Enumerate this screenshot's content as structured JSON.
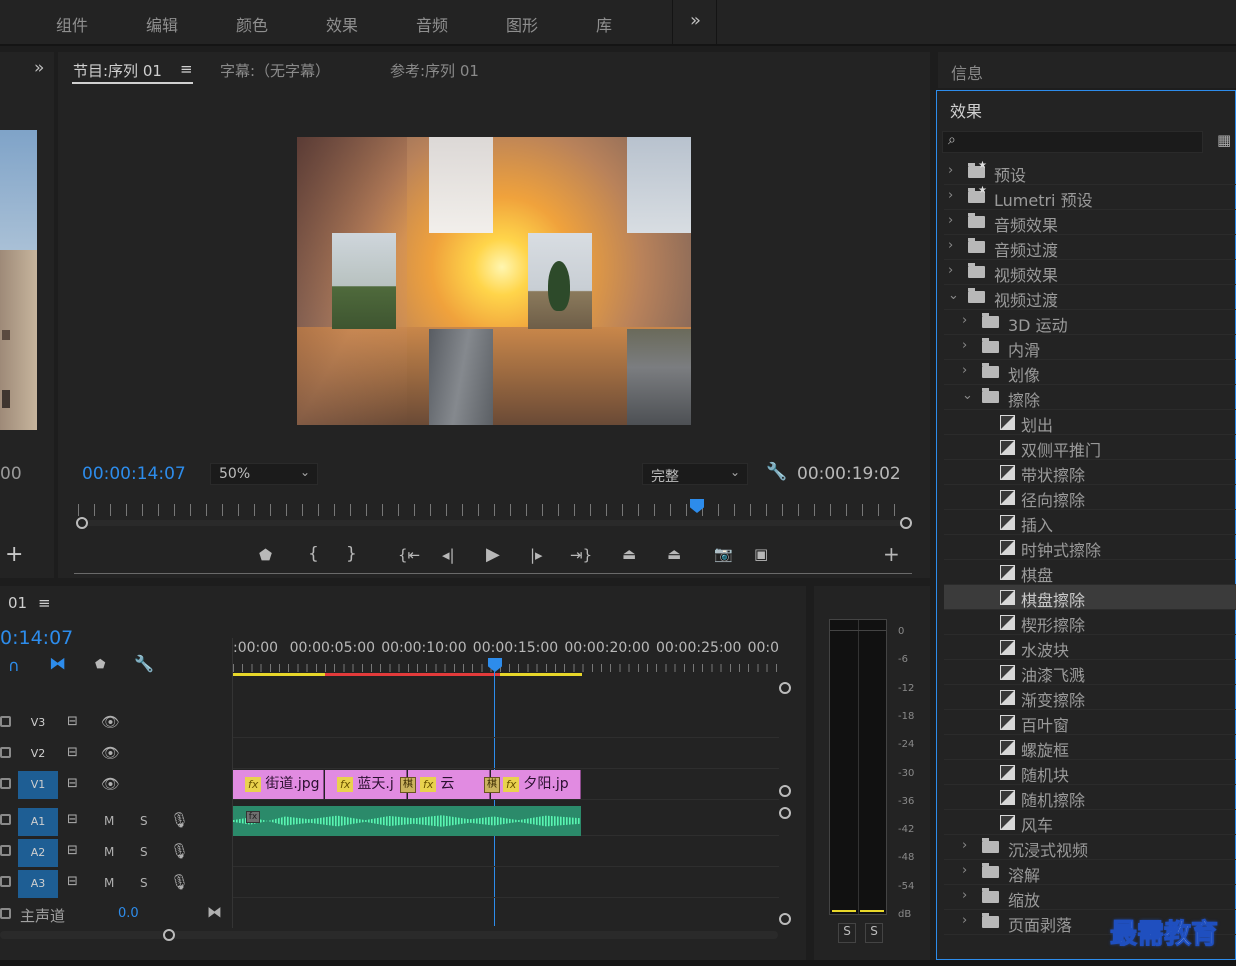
{
  "workspaces": {
    "tabs": [
      "组件",
      "编辑",
      "颜色",
      "效果",
      "音频",
      "图形",
      "库"
    ],
    "overflow": "»"
  },
  "program_monitor": {
    "tabs": [
      {
        "label": "节目:序列 01",
        "active": true
      },
      {
        "label": "字幕:（无字幕）"
      },
      {
        "label": "参考:序列 01"
      }
    ],
    "menu_icon": "≡",
    "timecode": "00:00:14:07",
    "zoom": "50%",
    "quality": "完整",
    "duration": "00:00:19:02",
    "playhead_fraction": 0.74,
    "buttons": [
      "marker-icon",
      "mark-in-icon",
      "mark-out-icon",
      "go-to-in-icon",
      "step-back-icon",
      "play-icon",
      "step-forward-icon",
      "go-to-out-icon",
      "lift-icon",
      "extract-icon",
      "export-frame-icon",
      "compare-icon",
      "add-button-icon"
    ]
  },
  "left_monitor": {
    "partial_time": "00",
    "overflow": "»",
    "add": "+"
  },
  "info_panel": {
    "title": "信息"
  },
  "effects_panel": {
    "title": "效果",
    "search_placeholder": "",
    "tree": [
      {
        "label": "预设",
        "level": 0,
        "kind": "star-folder",
        "open": false
      },
      {
        "label": "Lumetri 预设",
        "level": 0,
        "kind": "star-folder",
        "open": false
      },
      {
        "label": "音频效果",
        "level": 0,
        "kind": "folder",
        "open": false
      },
      {
        "label": "音频过渡",
        "level": 0,
        "kind": "folder",
        "open": false
      },
      {
        "label": "视频效果",
        "level": 0,
        "kind": "folder",
        "open": false
      },
      {
        "label": "视频过渡",
        "level": 0,
        "kind": "folder",
        "open": true
      },
      {
        "label": "3D 运动",
        "level": 1,
        "kind": "folder",
        "open": false
      },
      {
        "label": "内滑",
        "level": 1,
        "kind": "folder",
        "open": false
      },
      {
        "label": "划像",
        "level": 1,
        "kind": "folder",
        "open": false
      },
      {
        "label": "擦除",
        "level": 1,
        "kind": "folder",
        "open": true
      },
      {
        "label": "划出",
        "level": 2,
        "kind": "item"
      },
      {
        "label": "双侧平推门",
        "level": 2,
        "kind": "item"
      },
      {
        "label": "带状擦除",
        "level": 2,
        "kind": "item"
      },
      {
        "label": "径向擦除",
        "level": 2,
        "kind": "item"
      },
      {
        "label": "插入",
        "level": 2,
        "kind": "item"
      },
      {
        "label": "时钟式擦除",
        "level": 2,
        "kind": "item"
      },
      {
        "label": "棋盘",
        "level": 2,
        "kind": "item"
      },
      {
        "label": "棋盘擦除",
        "level": 2,
        "kind": "item",
        "selected": true
      },
      {
        "label": "楔形擦除",
        "level": 2,
        "kind": "item"
      },
      {
        "label": "水波块",
        "level": 2,
        "kind": "item"
      },
      {
        "label": "油漆飞溅",
        "level": 2,
        "kind": "item"
      },
      {
        "label": "渐变擦除",
        "level": 2,
        "kind": "item"
      },
      {
        "label": "百叶窗",
        "level": 2,
        "kind": "item"
      },
      {
        "label": "螺旋框",
        "level": 2,
        "kind": "item"
      },
      {
        "label": "随机块",
        "level": 2,
        "kind": "item"
      },
      {
        "label": "随机擦除",
        "level": 2,
        "kind": "item"
      },
      {
        "label": "风车",
        "level": 2,
        "kind": "item"
      },
      {
        "label": "沉浸式视频",
        "level": 1,
        "kind": "folder",
        "open": false
      },
      {
        "label": "溶解",
        "level": 1,
        "kind": "folder",
        "open": false
      },
      {
        "label": "缩放",
        "level": 1,
        "kind": "folder",
        "open": false
      },
      {
        "label": "页面剥落",
        "level": 1,
        "kind": "folder",
        "open": false
      }
    ]
  },
  "timeline": {
    "sequence_tab": "01",
    "menu_icon": "≡",
    "timecode": "0:14:07",
    "ruler": [
      ":00:00",
      "00:00:05:00",
      "00:00:10:00",
      "00:00:15:00",
      "00:00:20:00",
      "00:00:25:00",
      "00:0("
    ],
    "video_tracks": [
      {
        "name": "V3",
        "active": false
      },
      {
        "name": "V2",
        "active": false
      },
      {
        "name": "V1",
        "active": true
      }
    ],
    "audio_tracks": [
      {
        "name": "A1",
        "active": true,
        "m": "M",
        "s": "S"
      },
      {
        "name": "A2",
        "active": true,
        "m": "M",
        "s": "S"
      },
      {
        "name": "A3",
        "active": true,
        "m": "M",
        "s": "S"
      }
    ],
    "master": {
      "label": "主声道",
      "value": "0.0"
    },
    "clips": [
      {
        "label": "街道.jpg",
        "fx": "fx"
      },
      {
        "label": "蓝天.j",
        "fx": "fx"
      },
      {
        "label": "云",
        "fx": "fx"
      },
      {
        "label": "夕阳.jp",
        "fx": "fx"
      }
    ],
    "transition_label": "棋"
  },
  "audio_meter": {
    "scale": [
      "0",
      "-6",
      "-12",
      "-18",
      "-24",
      "-30",
      "-36",
      "-42",
      "-48",
      "-54",
      "dB"
    ],
    "solo": [
      "S",
      "S"
    ]
  },
  "watermark": "最需教育",
  "colors": {
    "accent": "#2d8ceb",
    "clip": "#e18be1",
    "audio_clip": "#2dbf8c",
    "panel": "#232323"
  }
}
